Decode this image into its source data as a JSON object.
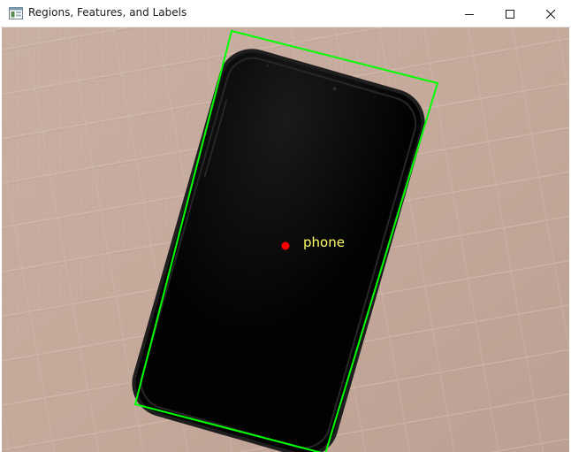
{
  "window": {
    "title": "Regions, Features, and Labels",
    "buttons": {
      "minimize": "minimize-icon",
      "maximize": "maximize-icon",
      "close": "close-icon"
    }
  },
  "annotations": [
    {
      "label": "phone",
      "label_color": "#ffff66",
      "box_color": "#00ff00",
      "center_color": "#ff0000"
    }
  ],
  "colors": {
    "background_surface": "#c8aea0",
    "phone_body": "#030303",
    "phone_bezel": "#2a2a2a"
  }
}
